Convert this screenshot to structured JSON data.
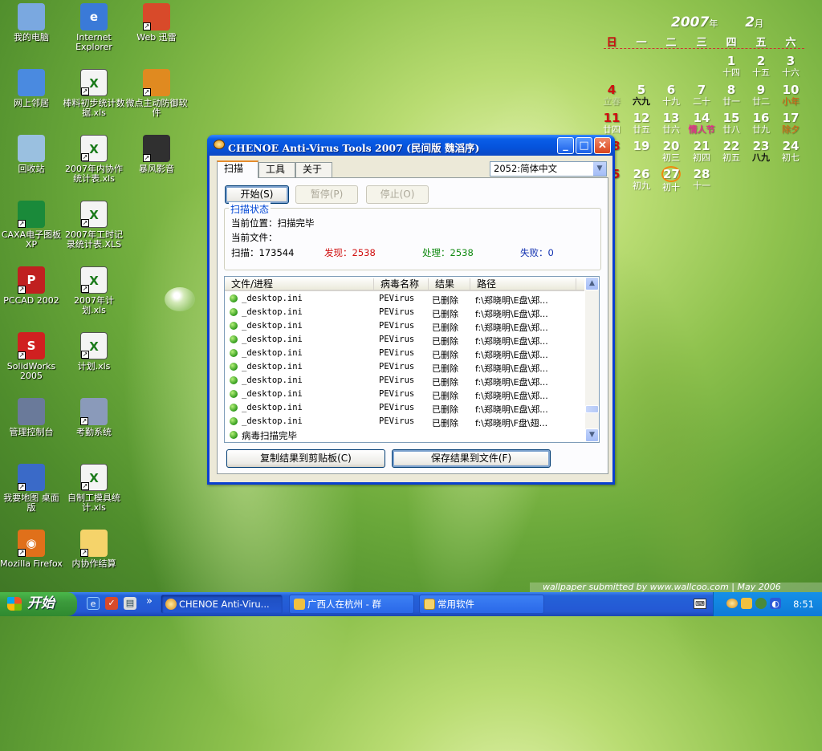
{
  "desktop": {
    "icons": [
      {
        "label": "我的电脑",
        "icon": "my-computer-icon"
      },
      {
        "label": "Internet Explorer",
        "icon": "internet-explorer-icon"
      },
      {
        "label": "Web 迅雷",
        "icon": "web-xunlei-icon"
      },
      {
        "label": "网上邻居",
        "icon": "network-places-icon"
      },
      {
        "label": "棒料初步统计数据.xls",
        "icon": "excel-file-icon"
      },
      {
        "label": "微点主动防御软件",
        "icon": "micropoint-icon"
      },
      {
        "label": "回收站",
        "icon": "recycle-bin-icon"
      },
      {
        "label": "2007年内协作统计表.xls",
        "icon": "excel-file-icon"
      },
      {
        "label": "暴风影音",
        "icon": "storm-player-icon"
      },
      {
        "label": "CAXA电子图板XP",
        "icon": "caxa-icon"
      },
      {
        "label": "2007年工时记录统计表.XLS",
        "icon": "excel-file-icon"
      },
      {
        "label": "PCCAD 2002",
        "icon": "pccad-icon"
      },
      {
        "label": "2007年计划.xls",
        "icon": "excel-file-icon"
      },
      {
        "label": "SolidWorks 2005",
        "icon": "solidworks-icon"
      },
      {
        "label": "计划.xls",
        "icon": "excel-file-icon"
      },
      {
        "label": "管理控制台",
        "icon": "management-console-icon"
      },
      {
        "label": "考勤系统",
        "icon": "attendance-system-icon"
      },
      {
        "label": "我要地图 桌面版",
        "icon": "map-desktop-icon"
      },
      {
        "label": "自制工模具统计.xls",
        "icon": "excel-file-icon"
      },
      {
        "label": "Mozilla Firefox",
        "icon": "firefox-icon"
      },
      {
        "label": "内协作结算",
        "icon": "folder-icon"
      }
    ],
    "watermark": "wallpaper submitted by www.wallcoo.com | May 2006"
  },
  "calendar": {
    "year": "2007",
    "year_suffix": "年",
    "month": "2",
    "month_suffix": "月",
    "weekdays": [
      "日",
      "一",
      "二",
      "三",
      "四",
      "五",
      "六"
    ],
    "days": [
      {
        "d": "1",
        "l": "十四"
      },
      {
        "d": "2",
        "l": "十五"
      },
      {
        "d": "3",
        "l": "十六"
      },
      {
        "d": "4",
        "l": "立春"
      },
      {
        "d": "5",
        "l": "六九"
      },
      {
        "d": "6",
        "l": "十九"
      },
      {
        "d": "7",
        "l": "二十"
      },
      {
        "d": "8",
        "l": "廿一"
      },
      {
        "d": "9",
        "l": "廿二"
      },
      {
        "d": "10",
        "l": "小年"
      },
      {
        "d": "11",
        "l": "廿四"
      },
      {
        "d": "12",
        "l": "廿五"
      },
      {
        "d": "13",
        "l": "廿六"
      },
      {
        "d": "14",
        "l": "情人节"
      },
      {
        "d": "15",
        "l": "廿八"
      },
      {
        "d": "16",
        "l": "廿九"
      },
      {
        "d": "17",
        "l": "除夕"
      },
      {
        "d": "18",
        "l": ""
      },
      {
        "d": "19",
        "l": ""
      },
      {
        "d": "20",
        "l": "初三"
      },
      {
        "d": "21",
        "l": "初四"
      },
      {
        "d": "22",
        "l": "初五"
      },
      {
        "d": "23",
        "l": "八九"
      },
      {
        "d": "24",
        "l": "初七"
      },
      {
        "d": "25",
        "l": ""
      },
      {
        "d": "26",
        "l": "初九"
      },
      {
        "d": "27",
        "l": "初十"
      },
      {
        "d": "28",
        "l": "十一"
      }
    ],
    "colors": {
      "sunday": "#d01010",
      "festival": "#e0338a",
      "holiday": "#e05a10",
      "today_ring": "#f08a10"
    }
  },
  "window": {
    "title": "CHENOE Anti-Virus Tools 2007 (民间版 魏滔序)",
    "tabs": [
      "扫描",
      "工具",
      "关于"
    ],
    "language": "2052:简体中文",
    "buttons": {
      "start": "开始(S)",
      "pause": "暂停(P)",
      "stop": "停止(O)"
    },
    "status": {
      "group_title": "扫描状态",
      "current_location": "当前位置：扫描完毕",
      "current_file": "当前文件：",
      "scanned": "扫描：173544",
      "found": "发现：2538",
      "handled": "处理：2538",
      "failed": "失败：0"
    },
    "list": {
      "columns": [
        "文件/进程",
        "病毒名称",
        "结果",
        "路径"
      ],
      "rows": [
        {
          "file": "_desktop.ini",
          "virus": "PEVirus",
          "result": "已删除",
          "path": "f:\\郑晓明\\E盘\\郑..."
        },
        {
          "file": "_desktop.ini",
          "virus": "PEVirus",
          "result": "已删除",
          "path": "f:\\郑晓明\\E盘\\郑..."
        },
        {
          "file": "_desktop.ini",
          "virus": "PEVirus",
          "result": "已删除",
          "path": "f:\\郑晓明\\E盘\\郑..."
        },
        {
          "file": "_desktop.ini",
          "virus": "PEVirus",
          "result": "已删除",
          "path": "f:\\郑晓明\\E盘\\郑..."
        },
        {
          "file": "_desktop.ini",
          "virus": "PEVirus",
          "result": "已删除",
          "path": "f:\\郑晓明\\E盘\\郑..."
        },
        {
          "file": "_desktop.ini",
          "virus": "PEVirus",
          "result": "已删除",
          "path": "f:\\郑晓明\\E盘\\郑..."
        },
        {
          "file": "_desktop.ini",
          "virus": "PEVirus",
          "result": "已删除",
          "path": "f:\\郑晓明\\E盘\\郑..."
        },
        {
          "file": "_desktop.ini",
          "virus": "PEVirus",
          "result": "已删除",
          "path": "f:\\郑晓明\\E盘\\郑..."
        },
        {
          "file": "_desktop.ini",
          "virus": "PEVirus",
          "result": "已删除",
          "path": "f:\\郑晓明\\E盘\\郑..."
        },
        {
          "file": "_desktop.ini",
          "virus": "PEVirus",
          "result": "已删除",
          "path": "f:\\郑晓明\\F盘\\翅..."
        }
      ],
      "final_row": "病毒扫描完毕"
    },
    "bottom_buttons": {
      "copy": "复制结果到剪贴板(C)",
      "save": "保存结果到文件(F)"
    }
  },
  "taskbar": {
    "start_label": "开始",
    "more": "»",
    "tasks": [
      {
        "label": "CHENOE Anti-Viru...",
        "icon": "antivirus-icon",
        "active": true
      },
      {
        "label": "广西人在杭州 - 群",
        "icon": "qq-group-icon",
        "active": false
      },
      {
        "label": "常用软件",
        "icon": "folder-icon",
        "active": false
      }
    ],
    "clock": "8:51"
  }
}
